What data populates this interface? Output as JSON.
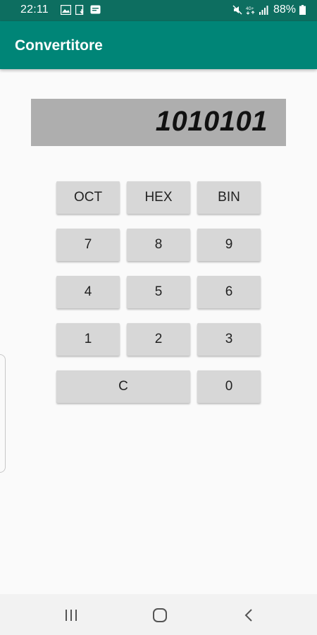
{
  "status_bar": {
    "time": "22:11",
    "battery": "88%",
    "icons": [
      "image-icon",
      "download-icon",
      "message-icon",
      "mute-icon",
      "4g-icon",
      "signal-icon",
      "battery-icon"
    ]
  },
  "app_bar": {
    "title": "Convertitore"
  },
  "display": {
    "value": "1010101"
  },
  "keypad": {
    "oct": "OCT",
    "hex": "HEX",
    "bin": "BIN",
    "k7": "7",
    "k8": "8",
    "k9": "9",
    "k4": "4",
    "k5": "5",
    "k6": "6",
    "k1": "1",
    "k2": "2",
    "k3": "3",
    "clear": "C",
    "k0": "0"
  },
  "nav_bar": {
    "icons": [
      "recent-apps-icon",
      "home-icon",
      "back-icon"
    ]
  },
  "colors": {
    "status_bar": "#0d6e60",
    "app_bar": "#008577",
    "display_bg": "#aeaeae",
    "button_bg": "#d7d7d7",
    "background": "#fafafa"
  }
}
